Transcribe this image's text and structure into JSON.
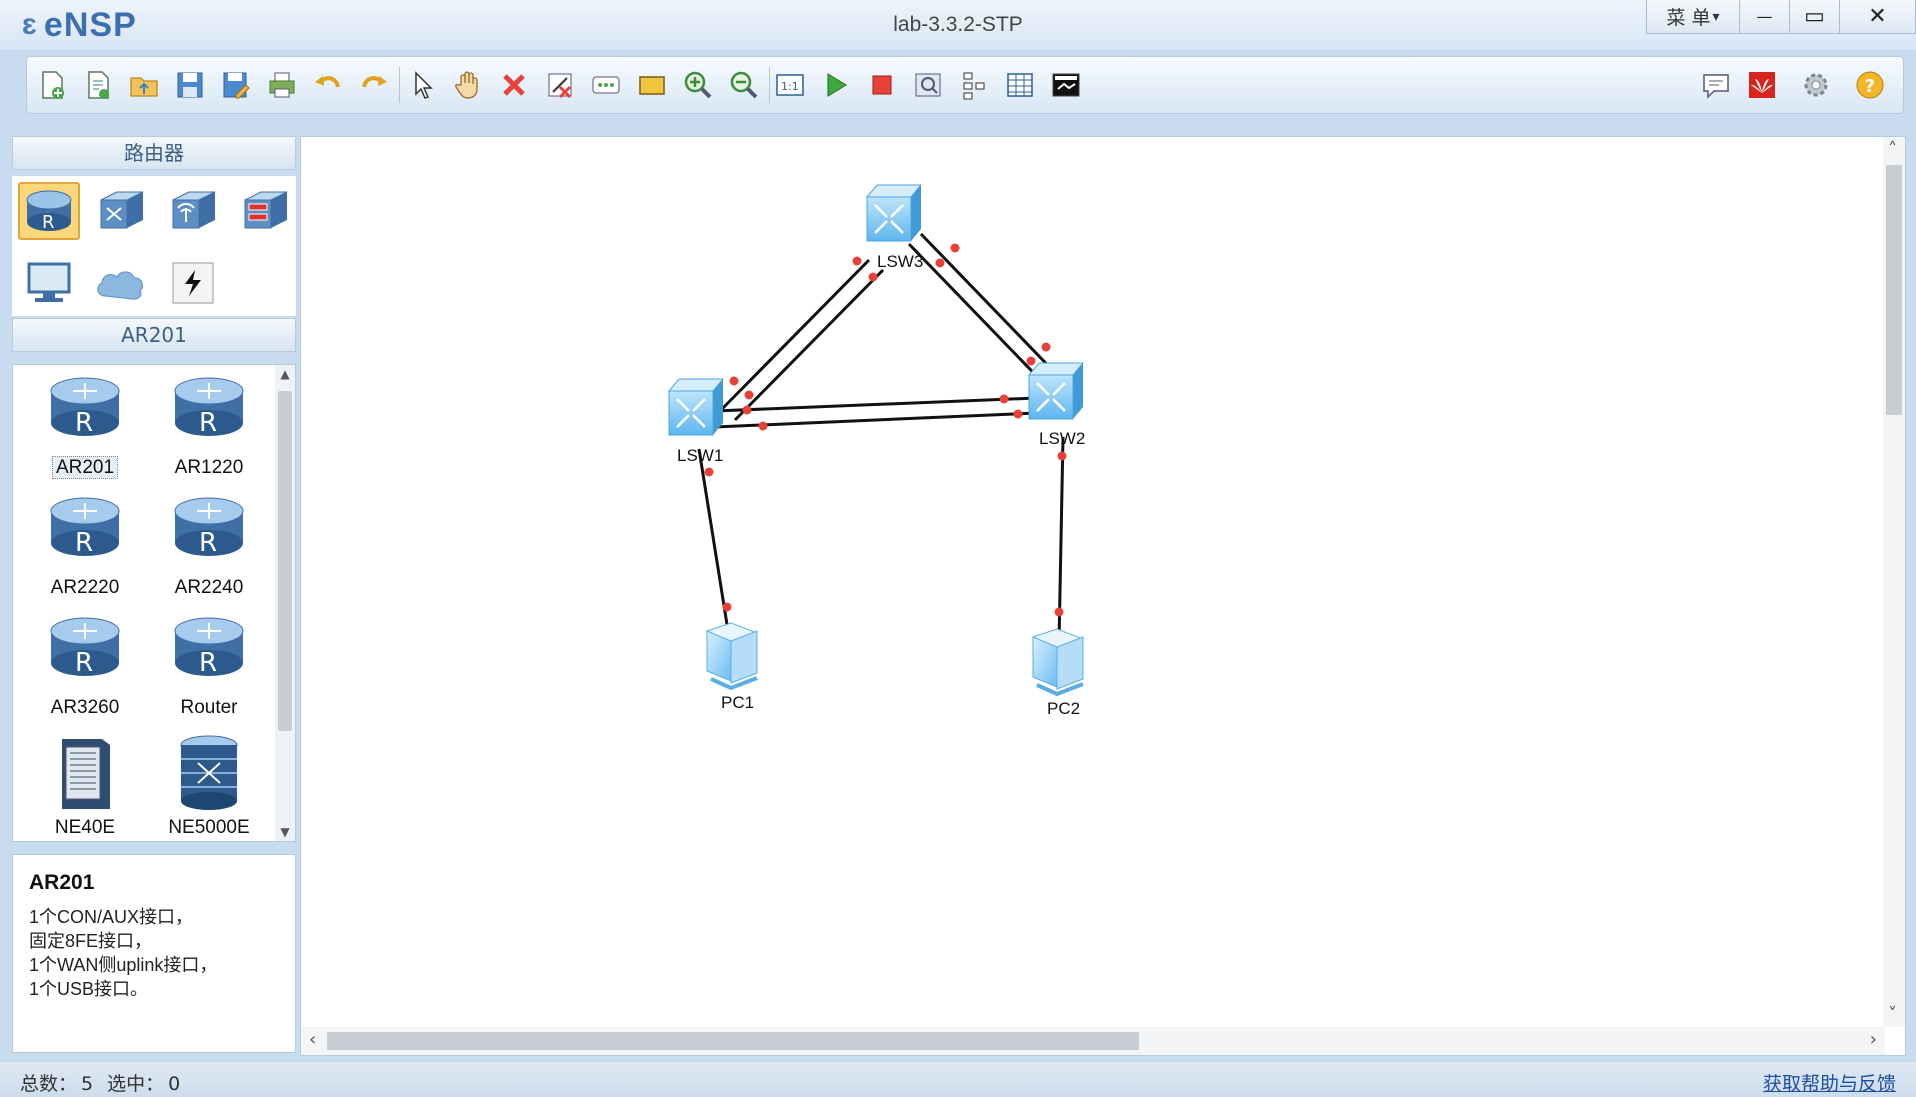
{
  "app": {
    "name": "eNSP",
    "window_title": "lab-3.3.2-STP"
  },
  "window_controls": {
    "menu_label": "菜 单",
    "menu_arrow": "▾",
    "minimize": "—",
    "maximize": "▭",
    "close": "✕"
  },
  "toolbar": {
    "buttons": [
      "new-topology-icon",
      "new-example-icon",
      "open-icon",
      "save-icon",
      "save-as-icon",
      "print-icon",
      "undo-icon",
      "redo-icon",
      "select-icon",
      "pan-hand-icon",
      "delete-icon",
      "delete-link-icon",
      "text-icon",
      "rectangle-icon",
      "zoom-in-icon",
      "zoom-out-icon",
      "fit-icon",
      "start-device-icon",
      "stop-device-icon",
      "capture-icon",
      "topology-icon",
      "grid-icon",
      "cli-icon"
    ],
    "right_buttons": [
      "chat-icon",
      "huawei-icon",
      "settings-icon",
      "help-icon"
    ]
  },
  "left_panel": {
    "category_header": "路由器",
    "categories": [
      "router-icon",
      "switch-icon",
      "wlan-icon",
      "firewall-icon",
      "pc-icon",
      "cloud-icon",
      "link-icon"
    ],
    "device_header": "AR201",
    "devices": [
      "AR201",
      "AR1220",
      "AR2220",
      "AR2240",
      "AR3260",
      "Router",
      "NE40E",
      "NE5000E"
    ],
    "info": {
      "title": "AR201",
      "lines": [
        "1个CON/AUX接口，",
        "固定8FE接口，",
        "1个WAN侧uplink接口，",
        "1个USB接口。"
      ]
    }
  },
  "topology": {
    "nodes": [
      {
        "id": "LSW3",
        "label": "LSW3",
        "type": "switch"
      },
      {
        "id": "LSW1",
        "label": "LSW1",
        "type": "switch"
      },
      {
        "id": "LSW2",
        "label": "LSW2",
        "type": "switch"
      },
      {
        "id": "PC1",
        "label": "PC1",
        "type": "pc"
      },
      {
        "id": "PC2",
        "label": "PC2",
        "type": "pc"
      }
    ],
    "links": [
      [
        "LSW3",
        "LSW1"
      ],
      [
        "LSW3",
        "LSW1"
      ],
      [
        "LSW3",
        "LSW2"
      ],
      [
        "LSW3",
        "LSW2"
      ],
      [
        "LSW1",
        "LSW2"
      ],
      [
        "LSW1",
        "LSW2"
      ],
      [
        "LSW1",
        "PC1"
      ],
      [
        "LSW2",
        "PC2"
      ]
    ],
    "link_color": "#111111",
    "port_color": "#e8413a"
  },
  "status": {
    "total_label": "总数：",
    "total": "5",
    "selected_label": "选中：",
    "selected": "0"
  },
  "help_link": "获取帮助与反馈",
  "colors": {
    "accent": "#3b6fae",
    "panel": "#c9dcef"
  }
}
